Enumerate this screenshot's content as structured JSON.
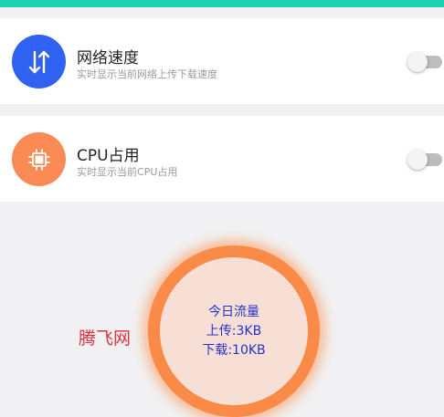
{
  "colors": {
    "top_bar": "#1ed3b3",
    "net_icon_bg": "#2f62f0",
    "cpu_icon_bg": "#fb8a55",
    "ring": "#fa8a48",
    "ring_inner": "#f8dfd6",
    "traffic_text": "#2432c8",
    "watermark": "#d8323c"
  },
  "settings": [
    {
      "title": "网络速度",
      "subtitle": "实时显示当前网络上传下载速度",
      "icon": "swap-arrows-icon",
      "enabled": false
    },
    {
      "title": "CPU占用",
      "subtitle": "实时显示当前CPU占用",
      "icon": "chip-icon",
      "enabled": false
    }
  ],
  "traffic": {
    "title": "今日流量",
    "upload": "上传:3KB",
    "download": "下载:10KB"
  },
  "watermark": "腾飞网"
}
